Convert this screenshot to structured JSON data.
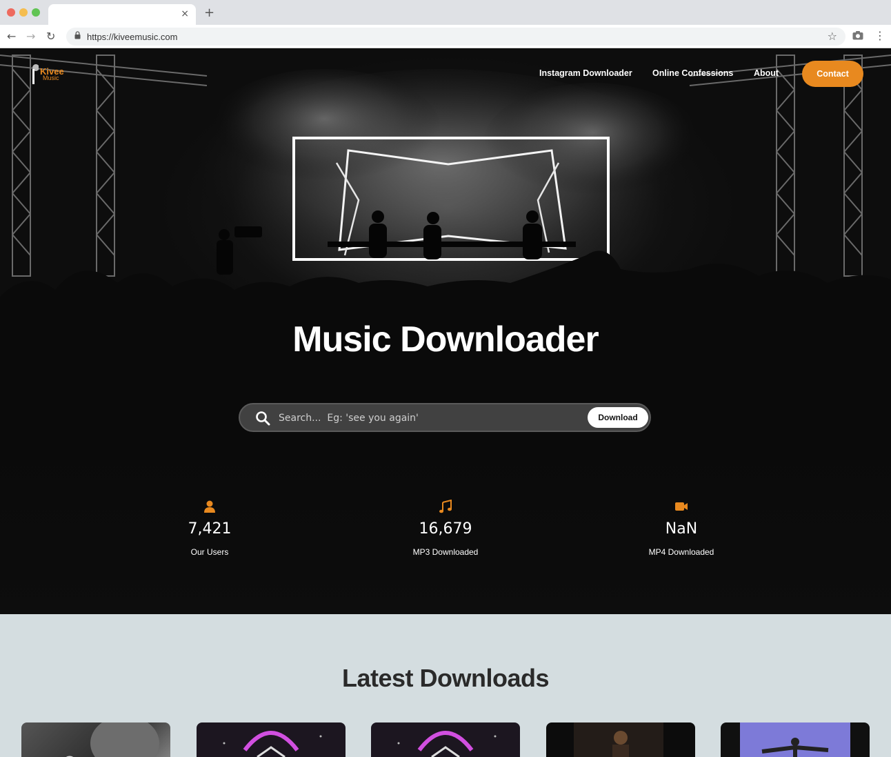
{
  "browser": {
    "url": "https://kiveemusic.com",
    "tab_close": "×",
    "new_tab": "+",
    "back": "←",
    "forward": "→",
    "reload": "↻",
    "star": "☆",
    "menu": "⋮"
  },
  "logo": {
    "name": "Kivee",
    "sub": "Music"
  },
  "nav": {
    "links": [
      "Instagram Downloader",
      "Online Confessions",
      "About"
    ],
    "contact": "Contact"
  },
  "hero": {
    "title": "Music Downloader",
    "search_placeholder": "Search...  Eg: 'see you again'",
    "download_label": "Download"
  },
  "stats": [
    {
      "icon": "user-icon",
      "value": "7,421",
      "label": "Our Users"
    },
    {
      "icon": "music-note-icon",
      "value": "16,679",
      "label": "MP3 Downloaded"
    },
    {
      "icon": "video-camera-icon",
      "value": "NaN",
      "label": "MP4 Downloaded"
    }
  ],
  "latest": {
    "title": "Latest Downloads",
    "cards": [
      "card-1",
      "card-2",
      "card-3",
      "card-4",
      "card-5"
    ]
  },
  "colors": {
    "accent": "#e8891f",
    "hero_bg": "#0d0d0d",
    "section_bg": "#d4dde0"
  }
}
